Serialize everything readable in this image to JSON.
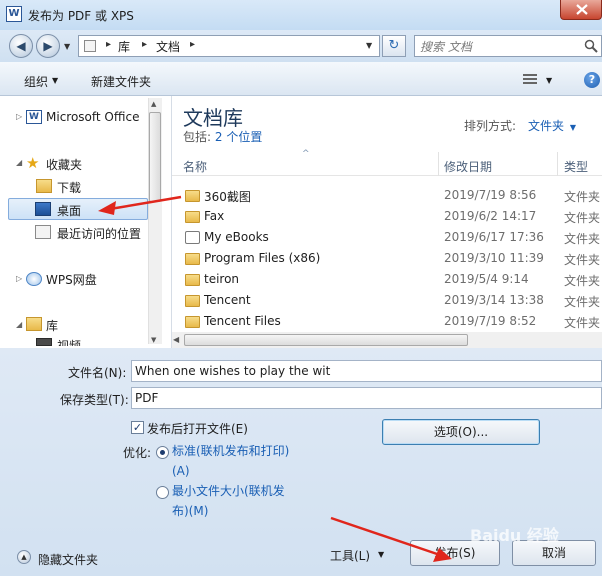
{
  "window": {
    "title": "发布为 PDF 或 XPS",
    "app_icon": "W"
  },
  "address": {
    "path": [
      "库",
      "文档"
    ],
    "search_placeholder": "搜索 文档"
  },
  "toolbar": {
    "organize": "组织",
    "new_folder": "新建文件夹"
  },
  "nav": {
    "items": [
      {
        "label": "Microsoft Office",
        "icon": "word-doc-icon"
      },
      {
        "label": "收藏夹",
        "icon": "star-icon"
      },
      {
        "label": "下载",
        "icon": "download-folder-icon"
      },
      {
        "label": "桌面",
        "icon": "desktop-icon"
      },
      {
        "label": "最近访问的位置",
        "icon": "recent-places-icon"
      },
      {
        "label": "WPS网盘",
        "icon": "cloud-icon"
      },
      {
        "label": "库",
        "icon": "library-icon"
      },
      {
        "label": "视频",
        "icon": "video-icon"
      }
    ]
  },
  "library": {
    "title": "文档库",
    "includes_label": "包括:",
    "includes_link": "2 个位置",
    "arrange_label": "排列方式:",
    "arrange_value": "文件夹"
  },
  "columns": {
    "name": "名称",
    "date": "修改日期",
    "type": "类型"
  },
  "files": [
    {
      "name": "360截图",
      "date": "2019/7/19 8:56",
      "type": "文件夹"
    },
    {
      "name": "Fax",
      "date": "2019/6/2 14:17",
      "type": "文件夹"
    },
    {
      "name": "My eBooks",
      "date": "2019/6/17 17:36",
      "type": "文件夹"
    },
    {
      "name": "Program Files (x86)",
      "date": "2019/3/10 11:39",
      "type": "文件夹"
    },
    {
      "name": "teiron",
      "date": "2019/5/4 9:14",
      "type": "文件夹"
    },
    {
      "name": "Tencent",
      "date": "2019/3/14 13:38",
      "type": "文件夹"
    },
    {
      "name": "Tencent Files",
      "date": "2019/7/19 8:52",
      "type": "文件夹"
    }
  ],
  "form": {
    "filename_label": "文件名(N):",
    "filename_value": "When one wishes to play the wit",
    "type_label": "保存类型(T):",
    "type_value": "PDF",
    "open_after_label": "发布后打开文件(E)",
    "optimize_label": "优化:",
    "opt_standard_line1": "标准(联机发布和打印)",
    "opt_standard_line2": "(A)",
    "opt_min_line1": "最小文件大小(联机发",
    "opt_min_line2": "布)(M)",
    "options_button": "选项(O)...",
    "tools_label": "工具(L)",
    "publish_button": "发布(S)",
    "cancel_button": "取消",
    "hide_folders": "隐藏文件夹"
  },
  "watermark": "Baidu 经验"
}
